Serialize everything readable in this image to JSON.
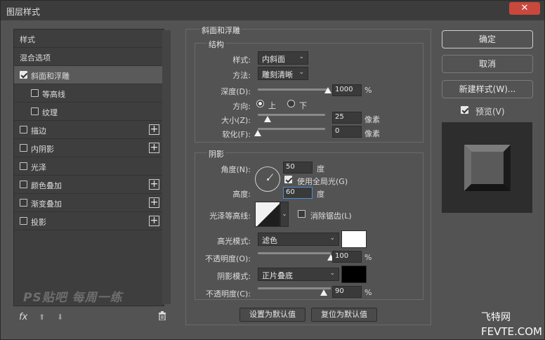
{
  "window": {
    "title": "图层样式",
    "close_glyph": "✕"
  },
  "style_list": {
    "items": [
      {
        "label": "样式",
        "has_checkbox": false,
        "checked": false,
        "has_plus": false,
        "selected": false,
        "indent": false
      },
      {
        "label": "混合选项",
        "has_checkbox": false,
        "checked": false,
        "has_plus": false,
        "selected": false,
        "indent": false
      },
      {
        "label": "斜面和浮雕",
        "has_checkbox": true,
        "checked": true,
        "has_plus": false,
        "selected": true,
        "indent": false
      },
      {
        "label": "等高线",
        "has_checkbox": true,
        "checked": false,
        "has_plus": false,
        "selected": false,
        "indent": true
      },
      {
        "label": "纹理",
        "has_checkbox": true,
        "checked": false,
        "has_plus": false,
        "selected": false,
        "indent": true
      },
      {
        "label": "描边",
        "has_checkbox": true,
        "checked": false,
        "has_plus": true,
        "selected": false,
        "indent": false
      },
      {
        "label": "内阴影",
        "has_checkbox": true,
        "checked": false,
        "has_plus": true,
        "selected": false,
        "indent": false
      },
      {
        "label": "光泽",
        "has_checkbox": true,
        "checked": false,
        "has_plus": false,
        "selected": false,
        "indent": false
      },
      {
        "label": "颜色叠加",
        "has_checkbox": true,
        "checked": false,
        "has_plus": true,
        "selected": false,
        "indent": false
      },
      {
        "label": "渐变叠加",
        "has_checkbox": true,
        "checked": false,
        "has_plus": true,
        "selected": false,
        "indent": false
      },
      {
        "label": "投影",
        "has_checkbox": true,
        "checked": false,
        "has_plus": true,
        "selected": false,
        "indent": false
      }
    ],
    "plus_glyph": "+",
    "watermark": "PS贴吧 每周一练",
    "fx_label": "fx",
    "up_glyph": "⬆",
    "down_glyph": "⬇",
    "trash_glyph": "🗑"
  },
  "bevel_emboss": {
    "section_title": "斜面和浮雕",
    "structure": {
      "title": "结构",
      "style_label": "样式:",
      "style_value": "内斜面",
      "technique_label": "方法:",
      "technique_value": "雕刻清晰",
      "depth_label": "深度(D):",
      "depth_value": "1000",
      "depth_unit": "%",
      "depth_level": 1.0,
      "direction_label": "方向:",
      "direction_up": "上",
      "direction_down": "下",
      "direction_selected": "上",
      "size_label": "大小(Z):",
      "size_value": "25",
      "size_unit": "像素",
      "size_level": 0.15,
      "soften_label": "软化(F):",
      "soften_value": "0",
      "soften_unit": "像素",
      "soften_level": 0.0
    },
    "shading": {
      "title": "阴影",
      "angle_label": "角度(N):",
      "angle_value": "50",
      "angle_unit": "度",
      "global_light_label": "使用全局光(G)",
      "global_light_checked": true,
      "altitude_label": "高度:",
      "altitude_value": "60",
      "altitude_unit": "度",
      "gloss_contour_label": "光泽等高线:",
      "anti_alias_label": "消除锯齿(L)",
      "anti_alias_checked": false,
      "highlight_mode_label": "高光模式:",
      "highlight_mode_value": "滤色",
      "highlight_color": "#ffffff",
      "highlight_opacity_label": "不透明度(O):",
      "highlight_opacity_value": "100",
      "highlight_opacity_unit": "%",
      "highlight_opacity_level": 1.0,
      "shadow_mode_label": "阴影模式:",
      "shadow_mode_value": "正片叠底",
      "shadow_color": "#000000",
      "shadow_opacity_label": "不透明度(C):",
      "shadow_opacity_value": "90",
      "shadow_opacity_unit": "%",
      "shadow_opacity_level": 0.9
    },
    "make_default_label": "设置为默认值",
    "reset_default_label": "复位为默认值"
  },
  "actions": {
    "ok_label": "确定",
    "cancel_label": "取消",
    "new_style_label": "新建样式(W)...",
    "preview_label": "预览(V)",
    "preview_checked": true
  },
  "branding": {
    "line1": "飞特网",
    "line2": "FEVTE.COM"
  }
}
